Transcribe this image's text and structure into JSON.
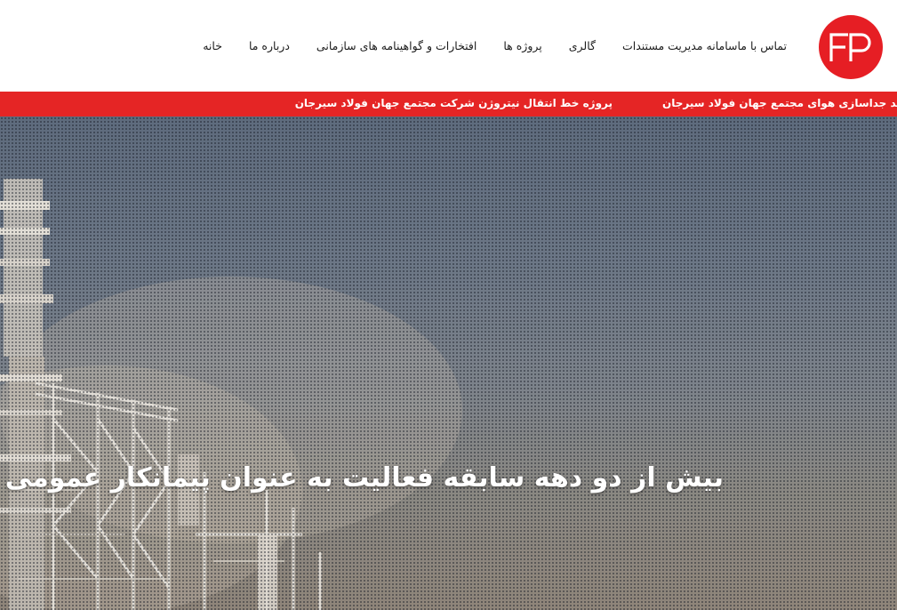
{
  "header": {
    "logo_icon": "fp-logo-icon",
    "logo_text": "FP",
    "brand_color": "#e61e24",
    "nav": [
      {
        "label": "خانه"
      },
      {
        "label": "درباره ما"
      },
      {
        "label": "افتخارات و گواهینامه های سازمانی"
      },
      {
        "label": "پروژه ها"
      },
      {
        "label": "گالری"
      },
      {
        "label": "سامانه مدیریت مستندات"
      },
      {
        "label": "تماس با ما"
      }
    ]
  },
  "ticker": {
    "background": "#e52525",
    "items": [
      {
        "text": "پروژه خط انتقال نیتروژن شرکت مجتمع جهان فولاد سیرجان"
      },
      {
        "text": "واحد جداسازی هوای مجتمع جهان فولاد سیرجان"
      }
    ]
  },
  "hero": {
    "title": "بیش از دو دهه سابقه فعالیت به عنوان پیمانکار عمومی"
  }
}
